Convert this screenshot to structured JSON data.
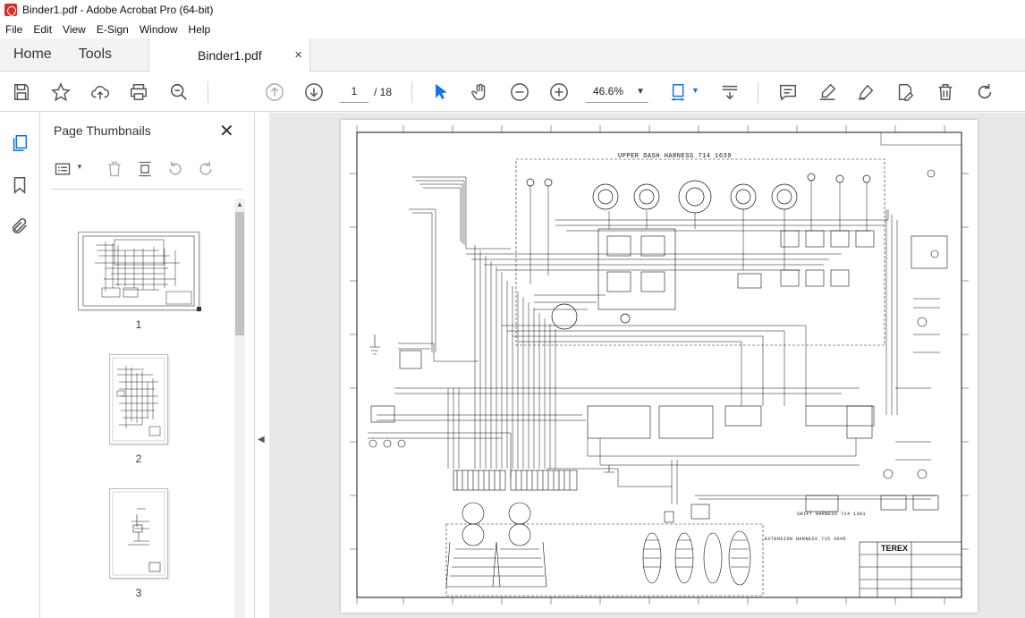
{
  "window": {
    "title": "Binder1.pdf - Adobe Acrobat Pro (64-bit)"
  },
  "menu": [
    "File",
    "Edit",
    "View",
    "E-Sign",
    "Window",
    "Help"
  ],
  "tabs": {
    "home": "Home",
    "tools": "Tools",
    "document": "Binder1.pdf",
    "close": "×"
  },
  "toolbar": {
    "current_page": "1",
    "page_total": "/ 18",
    "zoom": "46.6%",
    "caret": "▼"
  },
  "panel": {
    "title": "Page Thumbnails",
    "close": "✕",
    "thumbnails": [
      {
        "number": "1",
        "selected": true
      },
      {
        "number": "2",
        "selected": false
      },
      {
        "number": "3",
        "selected": false
      }
    ]
  },
  "document": {
    "labels": {
      "upper_dash": "UPPER DASH HARNESS 714 1639",
      "shift_harness": "SHIFT HARNESS 714 1301",
      "extension_harness": "EXTENSION HARNESS 715 3045",
      "brand": "TEREX"
    }
  },
  "colors": {
    "accent": "#1473e6",
    "chrome": "#f3f3f3",
    "viewer_bg": "#e8e8e8"
  }
}
